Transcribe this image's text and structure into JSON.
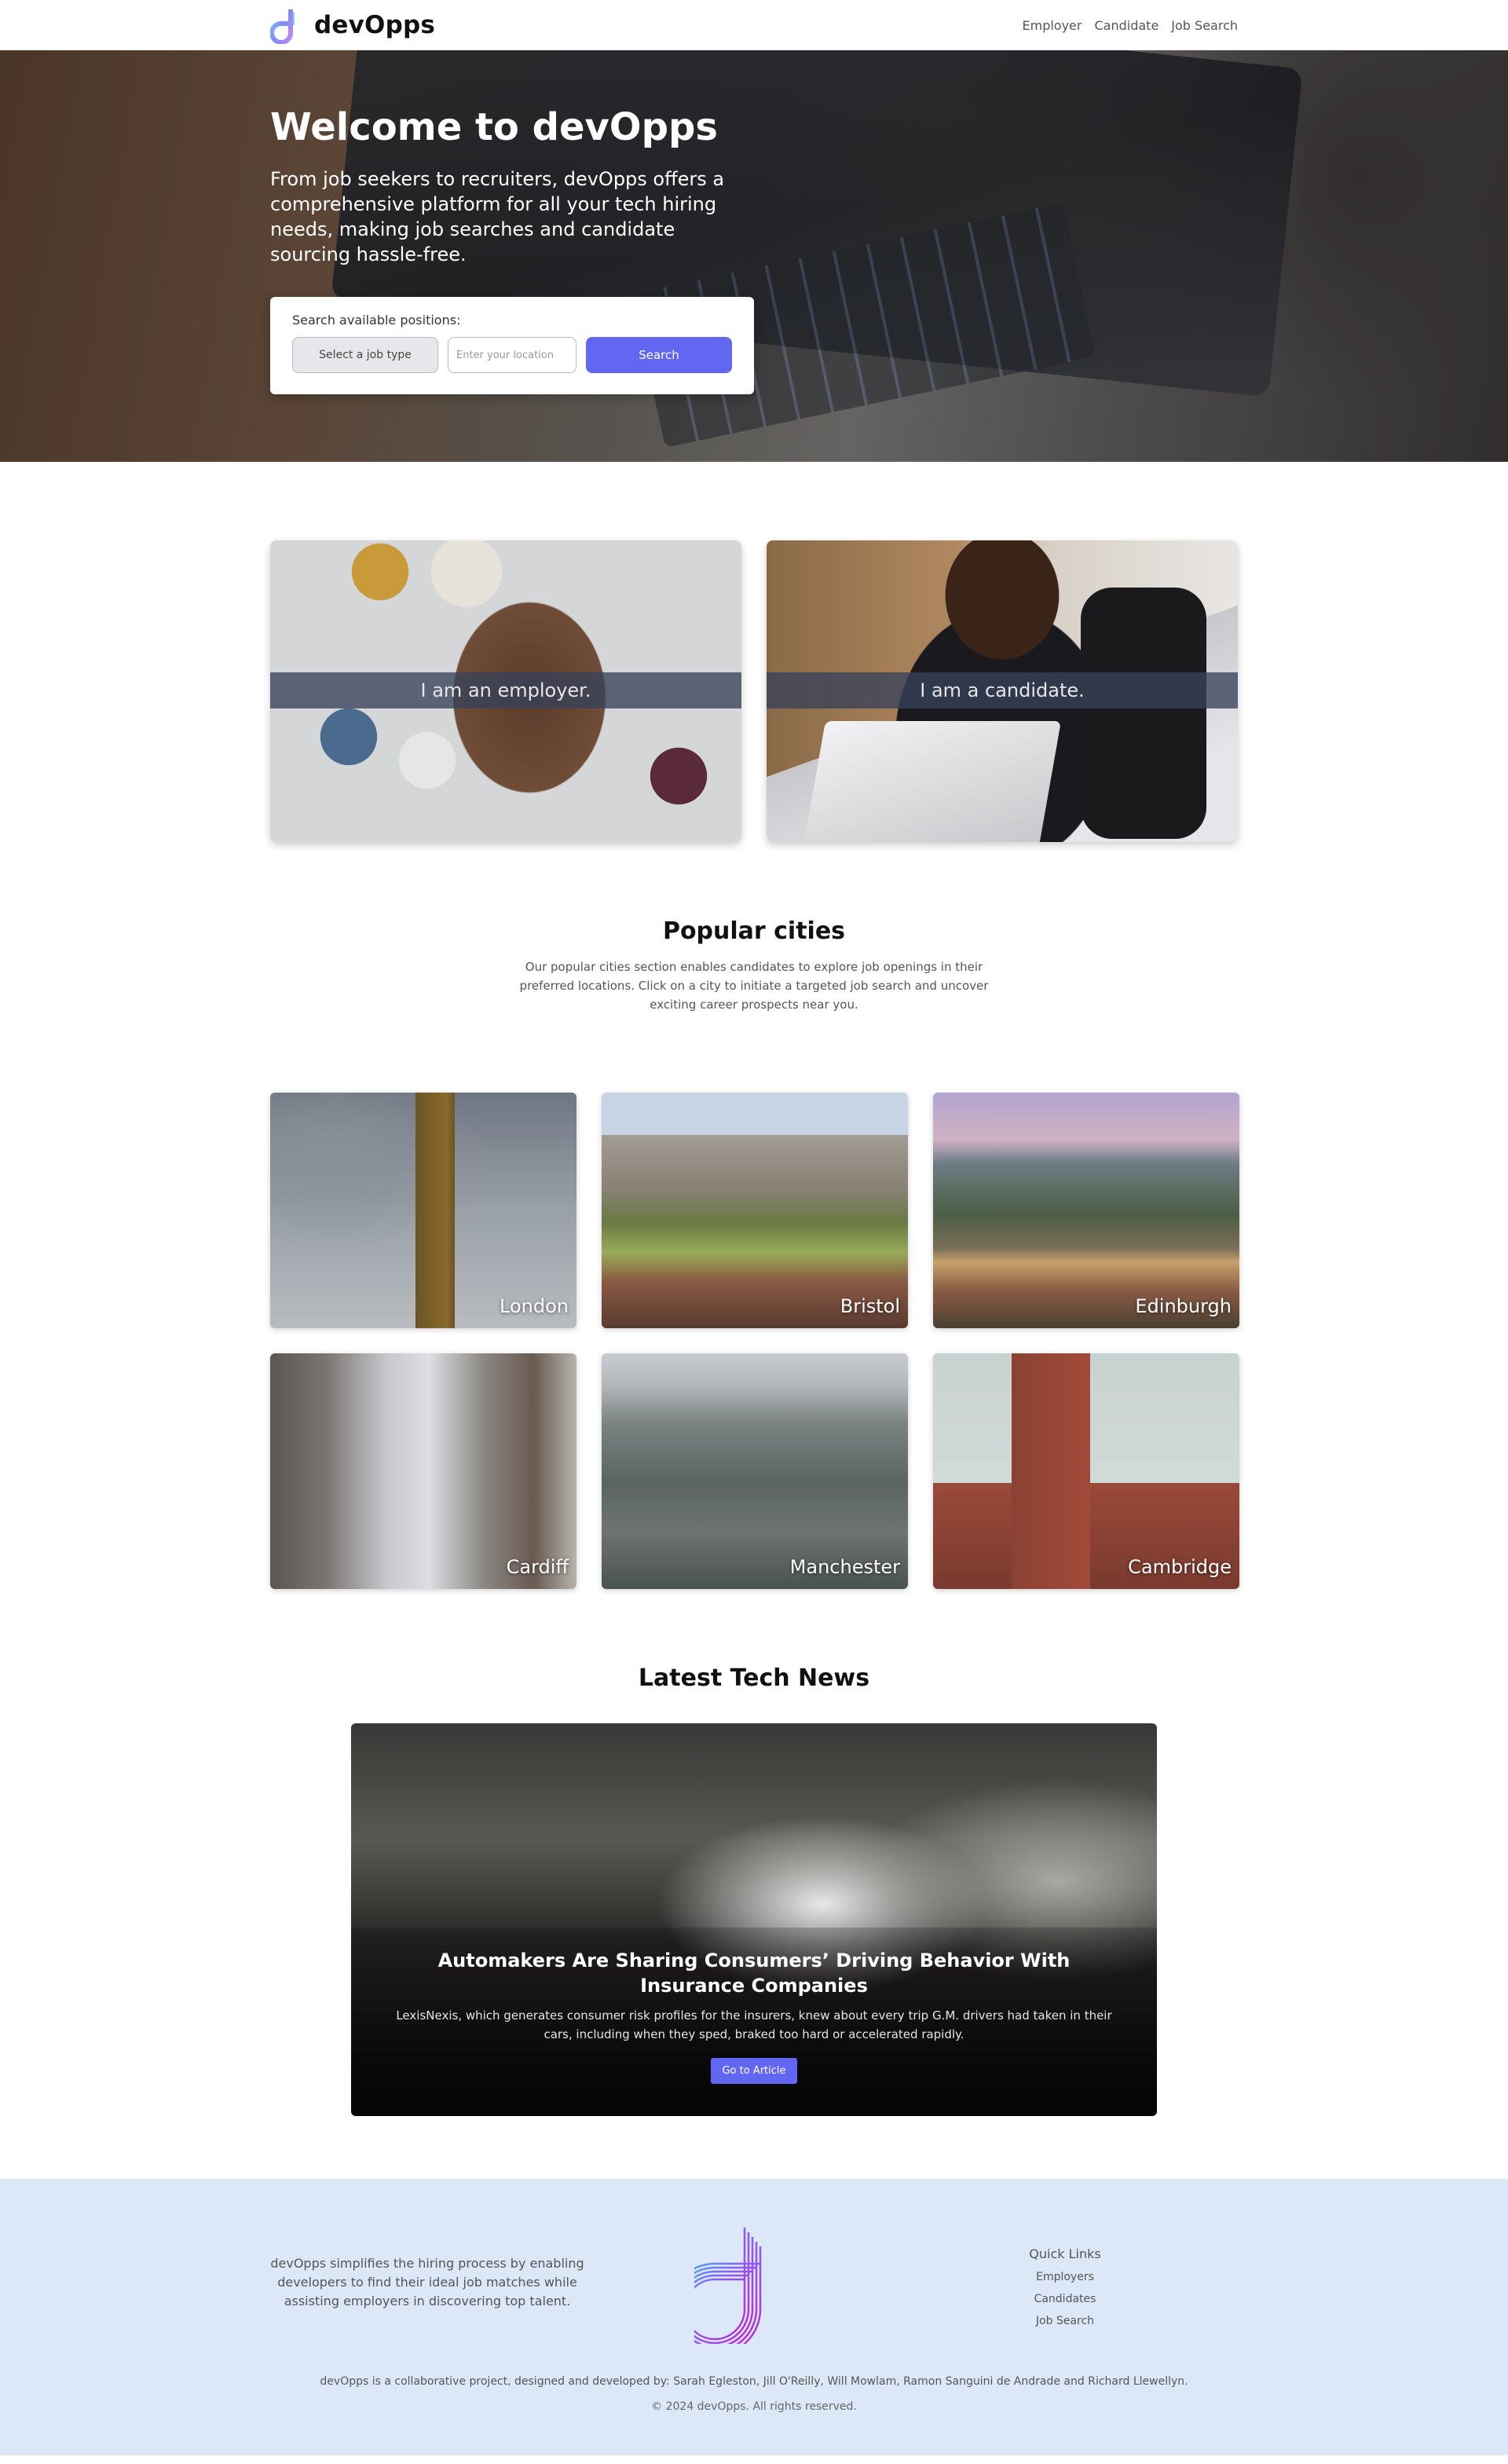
{
  "nav": {
    "brand": "devOpps",
    "links": [
      "Employer",
      "Candidate",
      "Job Search"
    ]
  },
  "hero": {
    "title": "Welcome to devOpps",
    "subtitle": "From job seekers to recruiters, devOpps offers a comprehensive platform for all your tech hiring needs, making job searches and candidate sourcing hassle-free.",
    "search_label": "Search available positions:",
    "job_type_selected": "Select a job type",
    "location_placeholder": "Enter your location",
    "search_button": "Search"
  },
  "roles": {
    "employer": "I am an employer.",
    "candidate": "I am a candidate."
  },
  "cities": {
    "title": "Popular cities",
    "description": "Our popular cities section enables candidates to explore job openings in their preferred locations. Click on a city to initiate a targeted job search and uncover exciting career prospects near you.",
    "items": [
      "London",
      "Bristol",
      "Edinburgh",
      "Cardiff",
      "Manchester",
      "Cambridge"
    ]
  },
  "news": {
    "title": "Latest Tech News",
    "headline": "Automakers Are Sharing Consumers’ Driving Behavior With Insurance Companies",
    "summary": "LexisNexis, which generates consumer risk profiles for the insurers, knew about every trip G.M. drivers had taken in their cars, including when they sped, braked too hard or accelerated rapidly.",
    "button": "Go to Article"
  },
  "footer": {
    "about": "devOpps simplifies the hiring process by enabling developers to find their ideal job matches while assisting employers in discovering top talent.",
    "quick_links_title": "Quick Links",
    "quick_links": [
      "Employers",
      "Candidates",
      "Job Search"
    ],
    "credit": "devOpps is a collaborative project, designed and developed by: Sarah Egleston, Jill O'Reilly, Will Mowlam, Ramon Sanguini de Andrade and Richard Llewellyn.",
    "copyright": "© 2024 devOpps. All rights reserved."
  },
  "colors": {
    "accent": "#6366f1",
    "footer_bg": "#dce8f8"
  }
}
